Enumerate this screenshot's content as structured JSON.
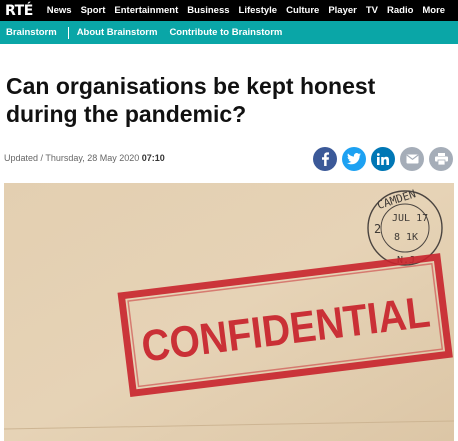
{
  "brand": {
    "logo": "RTÉ"
  },
  "top_nav": [
    "News",
    "Sport",
    "Entertainment",
    "Business",
    "Lifestyle",
    "Culture",
    "Player",
    "TV",
    "Radio",
    "More"
  ],
  "sub_nav": {
    "section": "Brainstorm",
    "about": "About Brainstorm",
    "contribute": "Contribute to Brainstorm"
  },
  "article": {
    "title": "Can organisations be kept honest during the pandemic?",
    "updated_label": "Updated / Thursday, 28 May 2020",
    "updated_time": "07:10",
    "image": {
      "stamp_text": "CONFIDENTIAL",
      "postmark": {
        "city": "CAMDEN",
        "date": "JUL 17",
        "line2": "8 1K",
        "left_digit": "2",
        "state": "N.J."
      }
    }
  },
  "share_icons": [
    "facebook-icon",
    "twitter-icon",
    "linkedin-icon",
    "email-icon",
    "print-icon"
  ],
  "colors": {
    "topbar": "#000000",
    "subbar": "#0aa6a7",
    "facebook": "#3b5998",
    "twitter": "#1da1f2",
    "linkedin": "#0077b5",
    "grey": "#a5adb8",
    "stamp_red": "#c8232c"
  }
}
